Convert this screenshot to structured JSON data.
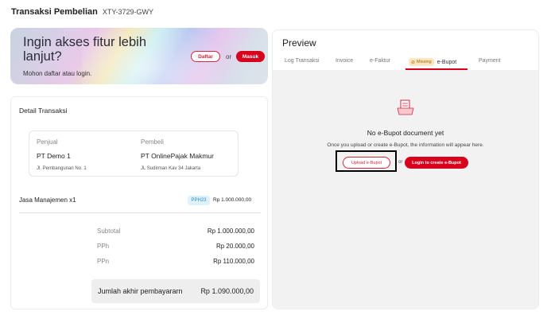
{
  "header": {
    "title": "Transaksi Pembelian",
    "code": "XTY-3729-GWY"
  },
  "banner": {
    "headline": "Ingin akses fitur lebih lanjut?",
    "subtitle": "Mohon daftar atau login.",
    "register_label": "Daftar",
    "or_label": "or",
    "login_label": "Masuk"
  },
  "detail": {
    "title": "Detail Transaksi",
    "seller": {
      "role": "Penjual",
      "name": "PT Demo 1",
      "address": "Jl. Pembangunan No. 1"
    },
    "buyer": {
      "role": "Pembeli",
      "name": "PT OnlinePajak Makmur",
      "address": "JL Sudirman Kav 34 Jakarta"
    },
    "item": {
      "name": "Jasa Manajemen  x1",
      "tax_badge": "PPH23",
      "price": "Rp 1.000.000,00"
    },
    "summary": [
      {
        "label": "Subtotal",
        "value": "Rp 1.000.000,00"
      },
      {
        "label": "PPh",
        "value": "Rp 20.000,00"
      },
      {
        "label": "PPn",
        "value": "Rp 110.000,00"
      }
    ],
    "total": {
      "label": "Jumlah akhir pembayararn",
      "value": "Rp 1.090.000,00"
    }
  },
  "preview": {
    "title": "Preview",
    "tabs": [
      {
        "label": "Log Transaksi"
      },
      {
        "label": "Invoice"
      },
      {
        "label": "e-Faktur"
      },
      {
        "label": "e-Bupot",
        "badge": "Missing",
        "active": true
      },
      {
        "label": "Payment"
      }
    ],
    "empty_title": "No e-Bupot document yet",
    "empty_hint": "Once you upload or create e-Bupot, the information will appear here.",
    "upload_label": "Upload e-Bupot",
    "or_label": "or",
    "login_create_label": "Login to create e-Bupot"
  },
  "colors": {
    "accent": "#d7011d",
    "badge_missing_bg": "#fbe7c2",
    "tax_badge_bg": "#dff1fb"
  },
  "icons": {
    "document": "document-icon",
    "missing": "warning-icon"
  }
}
